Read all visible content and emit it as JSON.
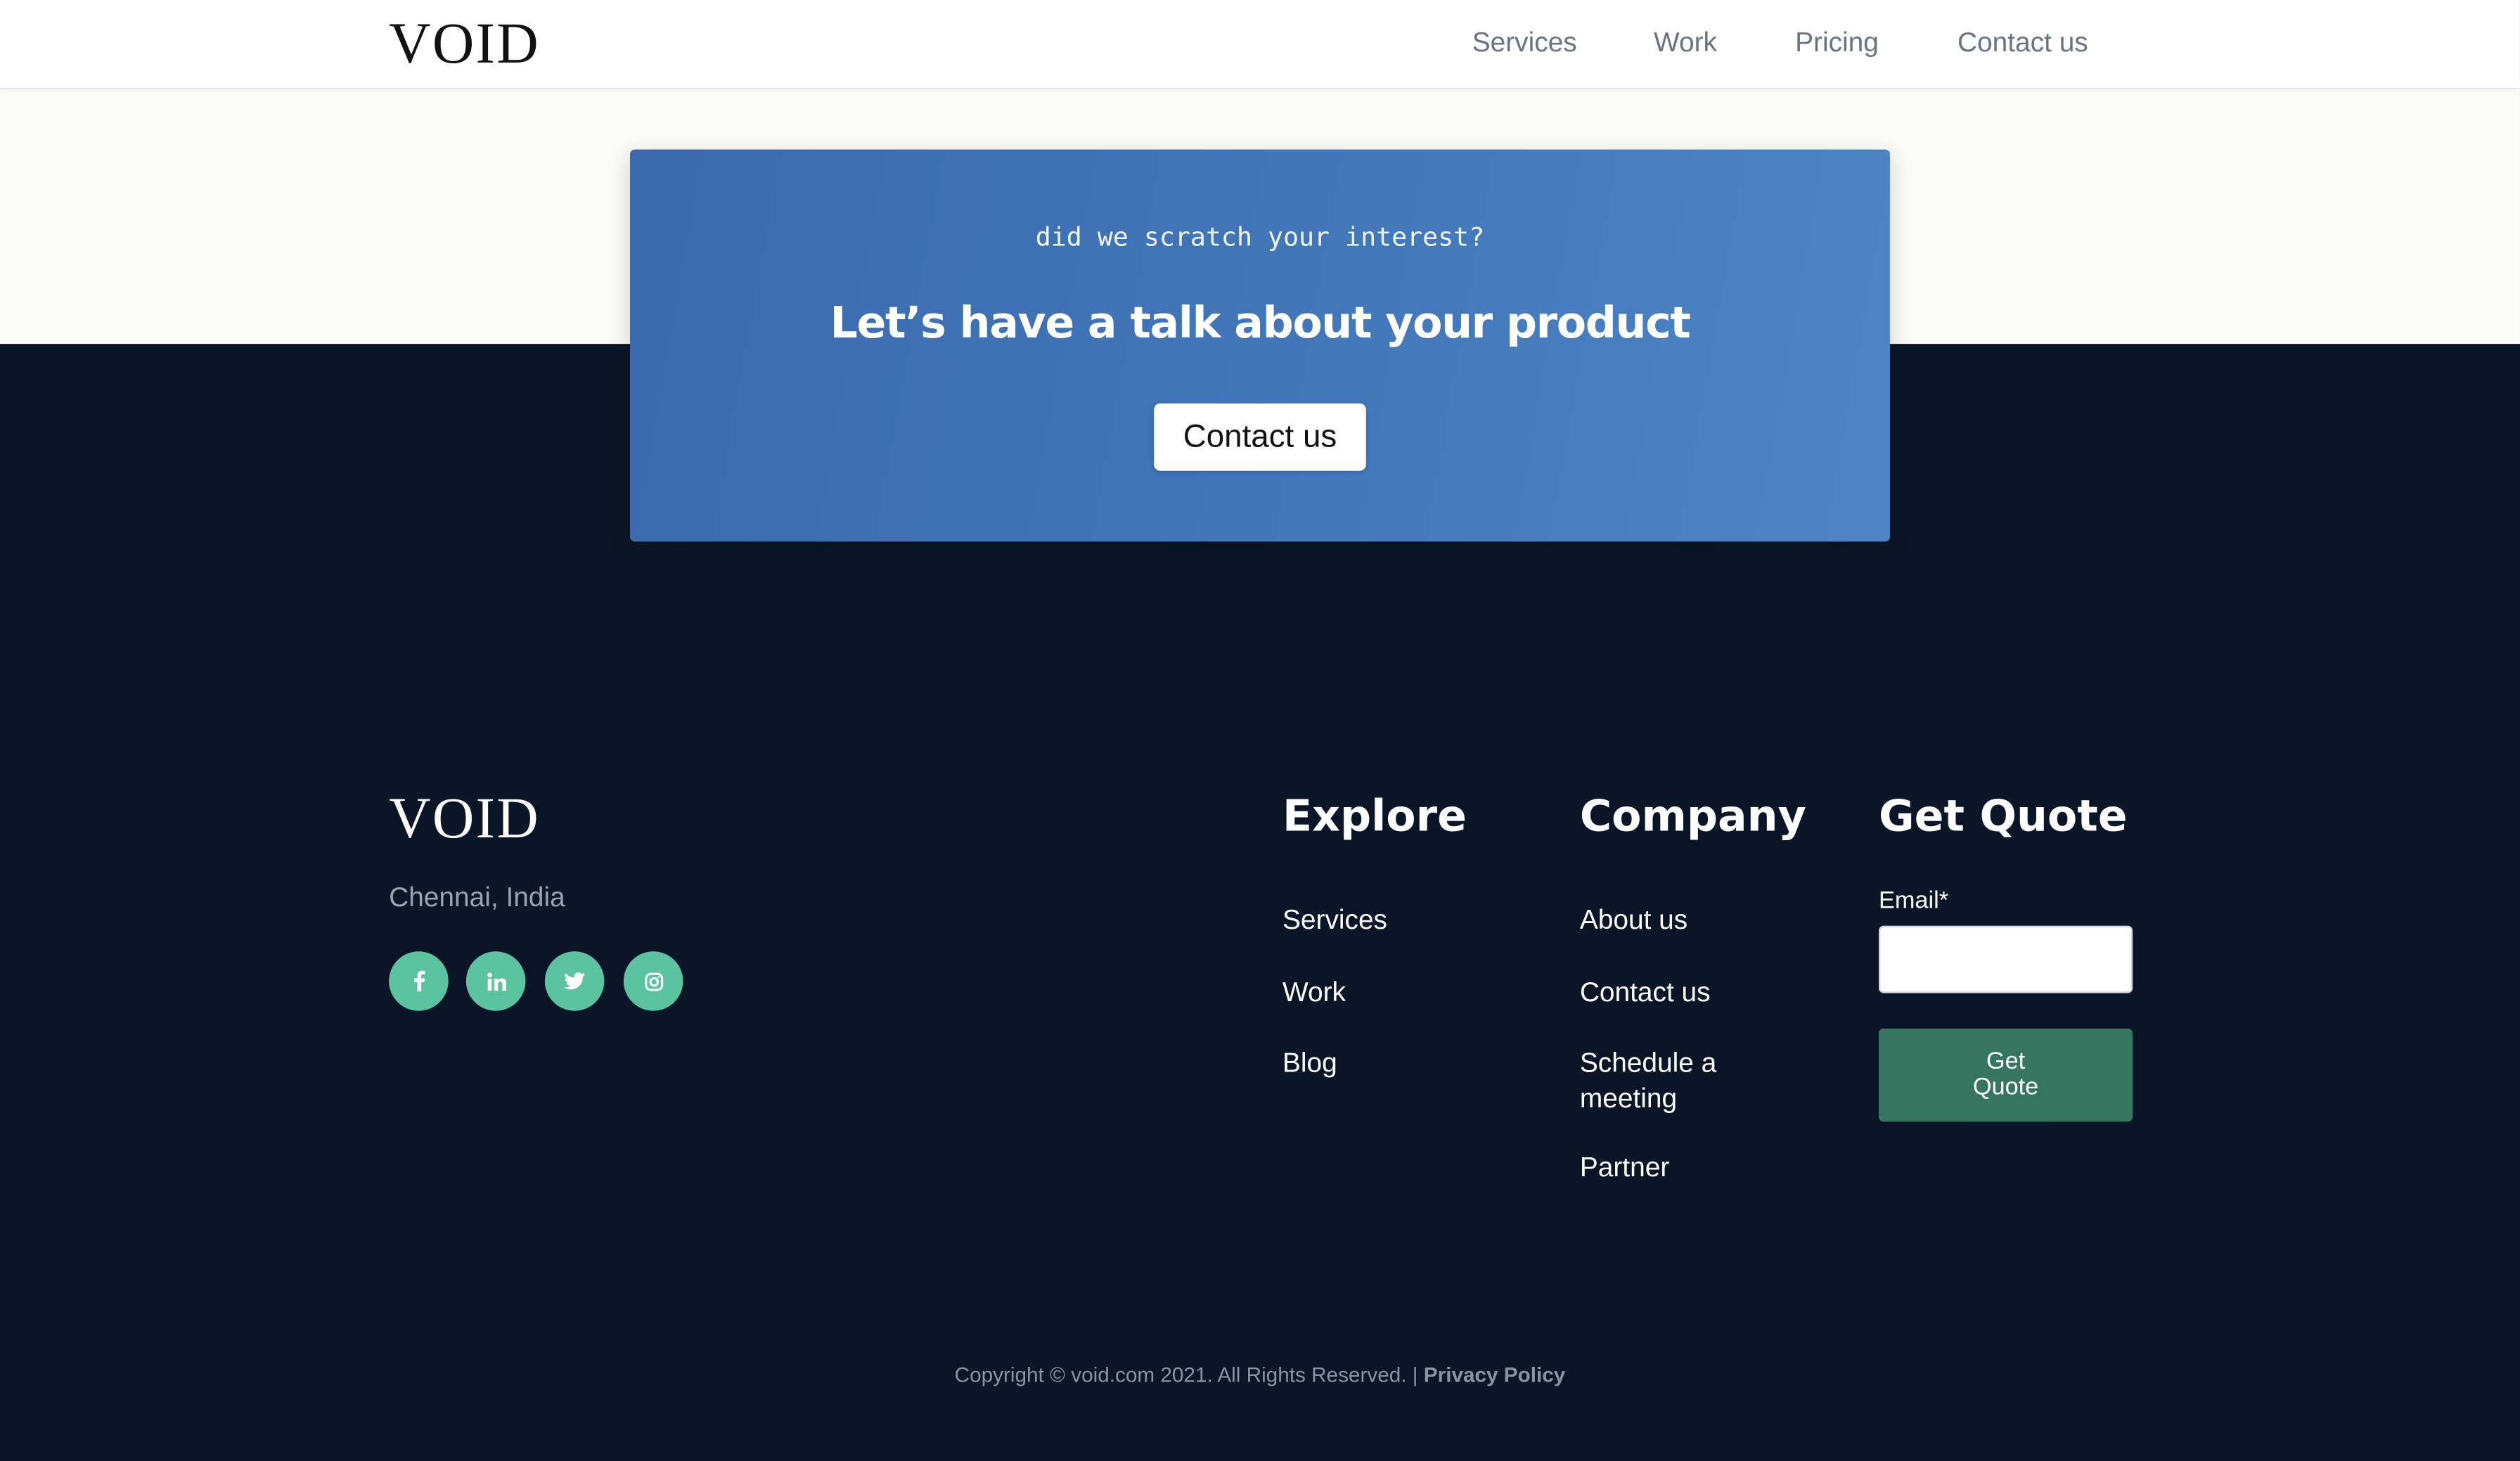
{
  "header": {
    "logo": "VOID",
    "nav": [
      "Services",
      "Work",
      "Pricing",
      "Contact us"
    ]
  },
  "cta": {
    "kicker": "did we scratch your interest?",
    "headline": "Let’s have a talk about your product",
    "button": "Contact us"
  },
  "footer": {
    "logo": "VOID",
    "location": "Chennai, India",
    "socials": [
      "facebook-icon",
      "linkedin-icon",
      "twitter-icon",
      "instagram-icon"
    ],
    "explore": {
      "title": "Explore",
      "links": [
        "Services",
        "Work",
        "Blog"
      ]
    },
    "company": {
      "title": "Company",
      "links": [
        "About us",
        "Contact us",
        "Schedule a meeting",
        "Partner"
      ]
    },
    "quote": {
      "title": "Get Quote",
      "email_label": "Email*",
      "email_value": "",
      "button": "Get Quote"
    },
    "copyright": "Copyright © void.com 2021. All Rights Reserved. |",
    "privacy": "Privacy Policy"
  },
  "colors": {
    "footer_bg": "#0a1627",
    "card_blue": "#4277ba",
    "social_green": "#5cc3a0",
    "quote_green": "#367560"
  }
}
